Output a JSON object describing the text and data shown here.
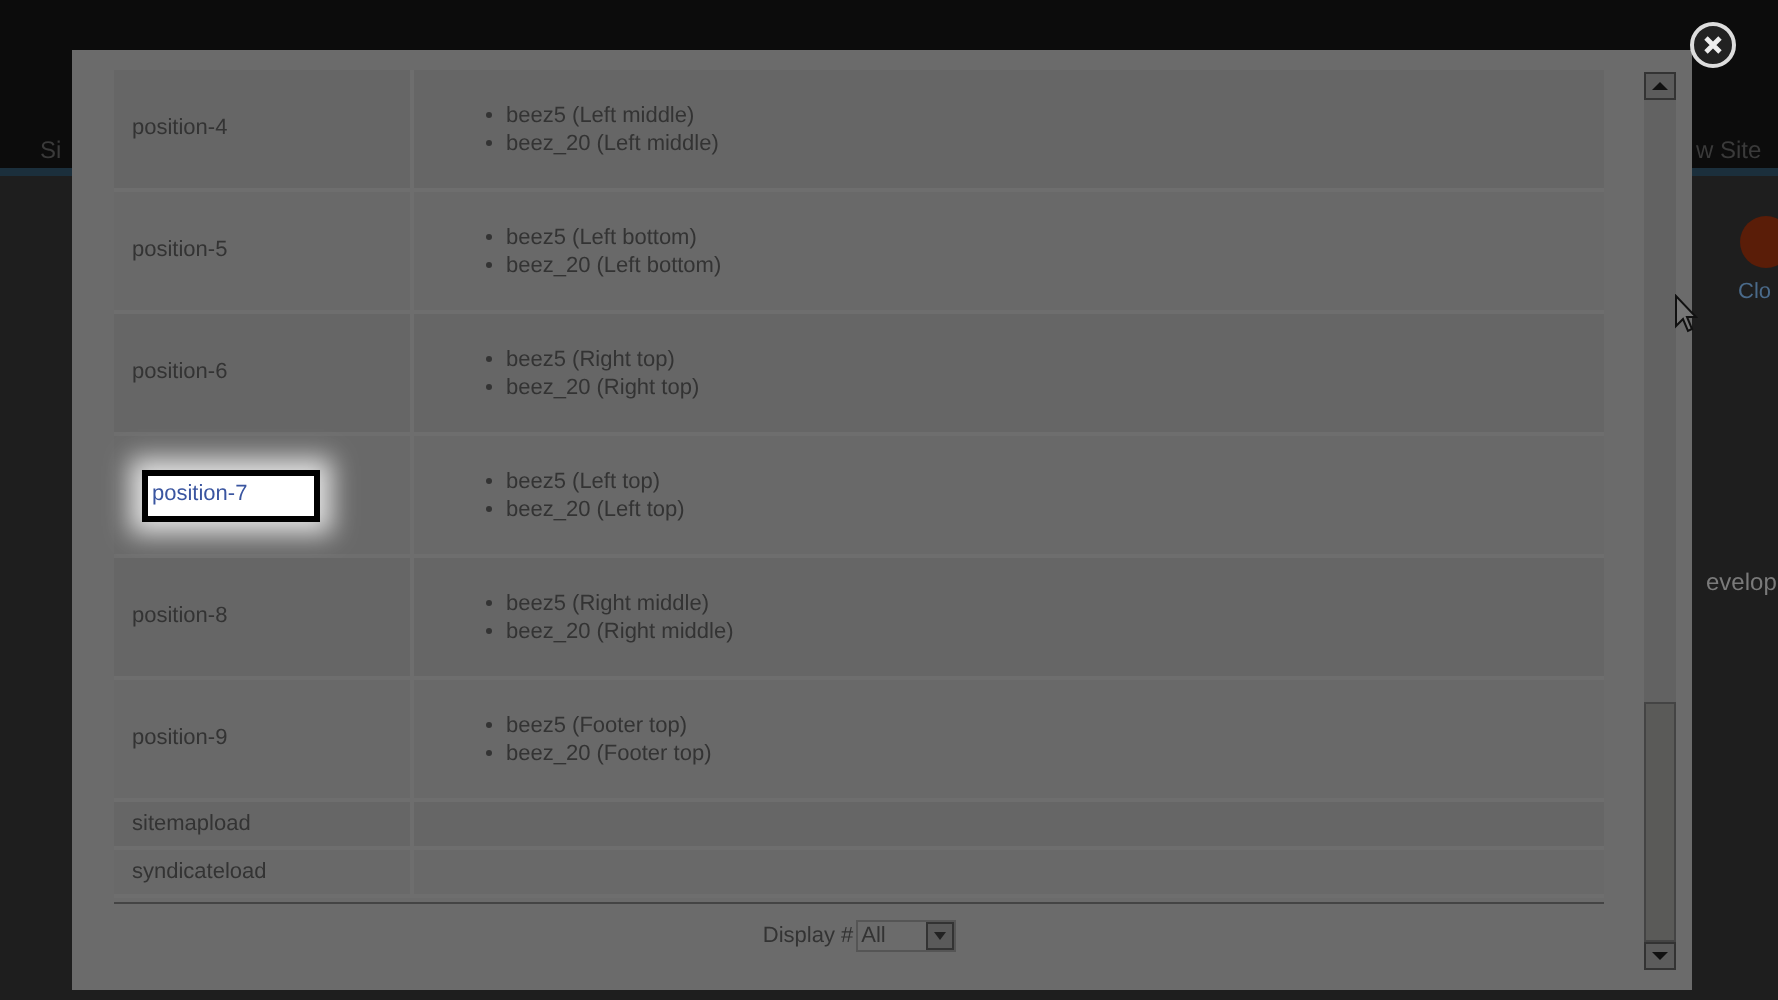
{
  "background": {
    "menu_left": "Si",
    "menu_right": "w Site",
    "toolbar_button": "Clo",
    "side_text": "evelop"
  },
  "table": {
    "rows": [
      {
        "name": "position-4",
        "highlighted": false,
        "templates": [
          "beez5 (Left middle)",
          "beez_20 (Left middle)"
        ]
      },
      {
        "name": "position-5",
        "highlighted": false,
        "templates": [
          "beez5 (Left bottom)",
          "beez_20 (Left bottom)"
        ]
      },
      {
        "name": "position-6",
        "highlighted": false,
        "templates": [
          "beez5 (Right top)",
          "beez_20 (Right top)"
        ]
      },
      {
        "name": "position-7",
        "highlighted": true,
        "templates": [
          "beez5 (Left top)",
          "beez_20 (Left top)"
        ]
      },
      {
        "name": "position-8",
        "highlighted": false,
        "templates": [
          "beez5 (Right middle)",
          "beez_20 (Right middle)"
        ]
      },
      {
        "name": "position-9",
        "highlighted": false,
        "templates": [
          "beez5 (Footer top)",
          "beez_20 (Footer top)"
        ]
      },
      {
        "name": "sitemapload",
        "highlighted": false,
        "templates": []
      },
      {
        "name": "syndicateload",
        "highlighted": false,
        "templates": []
      }
    ]
  },
  "pagination": {
    "label": "Display #",
    "value": "All"
  }
}
